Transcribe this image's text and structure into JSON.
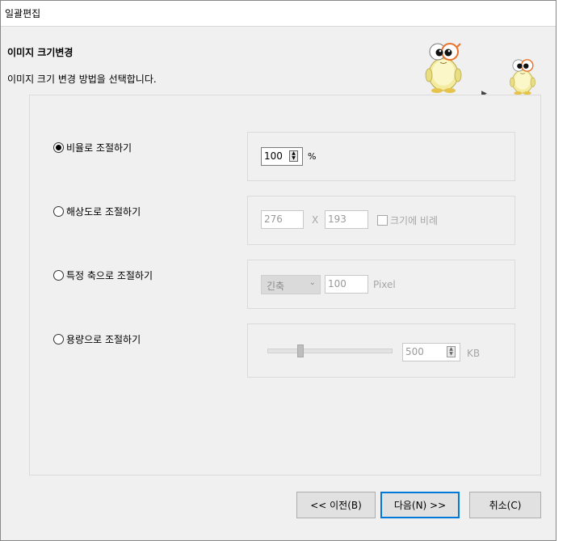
{
  "window": {
    "title": "일괄편집"
  },
  "header": {
    "title": "이미지 크기변경",
    "subtitle": "이미지 크기 변경 방법을 선택합니다."
  },
  "options": {
    "ratio": {
      "label": "비율로 조절하기",
      "selected": true,
      "value": "100",
      "unit": "%"
    },
    "resolution": {
      "label": "해상도로 조절하기",
      "selected": false,
      "width": "276",
      "separator": "X",
      "height": "193",
      "keep_ratio_label": "크기에 비례",
      "keep_ratio_checked": false
    },
    "axis": {
      "label": "특정 축으로 조절하기",
      "selected": false,
      "axis_value": "긴축",
      "value": "100",
      "unit": "Pixel"
    },
    "filesize": {
      "label": "용량으로 조절하기",
      "selected": false,
      "value": "500",
      "unit": "KB",
      "slider_level": 0.25
    }
  },
  "buttons": {
    "prev": "<< 이전(B)",
    "next": "다음(N) >>",
    "cancel": "취소(C)"
  },
  "colors": {
    "focus": "#0078d7",
    "panel": "#f0f0f0"
  }
}
